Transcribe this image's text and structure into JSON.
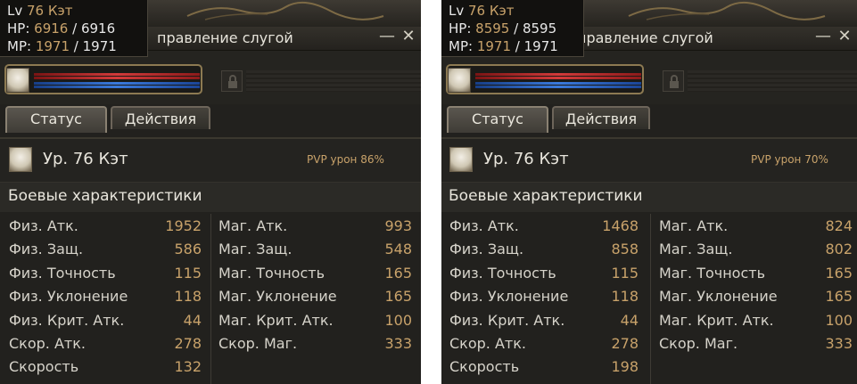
{
  "window_title": "правление слугой",
  "tabs": [
    "Статус",
    "Действия"
  ],
  "section_title": "Боевые характеристики",
  "panels": [
    {
      "tooltip": {
        "lv_label": "Lv",
        "lv_value": "76 Кэт",
        "hp_label": "HP:",
        "hp_cur": "6916",
        "hp_max": "/ 6916",
        "mp_label": "MP:",
        "mp_cur": "1971",
        "mp_max": "/ 1971"
      },
      "name_level_label": "Ур.",
      "name_level_value": "76 Кэт",
      "pvp": "PVP урон 86%",
      "left_stats": [
        {
          "label": "Физ. Атк.",
          "value": "1952"
        },
        {
          "label": "Физ. Защ.",
          "value": "586"
        },
        {
          "label": "Физ. Точность",
          "value": "115"
        },
        {
          "label": "Физ. Уклонение",
          "value": "118"
        },
        {
          "label": "Физ. Крит. Атк.",
          "value": "44"
        },
        {
          "label": "Скор. Атк.",
          "value": "278"
        },
        {
          "label": "Скорость",
          "value": "132"
        }
      ],
      "right_stats": [
        {
          "label": "Маг. Атк.",
          "value": "993"
        },
        {
          "label": "Маг. Защ.",
          "value": "548"
        },
        {
          "label": "Маг. Точность",
          "value": "165"
        },
        {
          "label": "Маг. Уклонение",
          "value": "165"
        },
        {
          "label": "Маг. Крит. Атк.",
          "value": "100"
        },
        {
          "label": "Скор. Маг.",
          "value": "333"
        }
      ]
    },
    {
      "tooltip": {
        "lv_label": "Lv",
        "lv_value": "76 Кэт",
        "hp_label": "HP:",
        "hp_cur": "8595",
        "hp_max": "/ 8595",
        "mp_label": "MP:",
        "mp_cur": "1971",
        "mp_max": "/ 1971"
      },
      "name_level_label": "Ур.",
      "name_level_value": "76 Кэт",
      "pvp": "PVP урон 70%",
      "left_stats": [
        {
          "label": "Физ. Атк.",
          "value": "1468"
        },
        {
          "label": "Физ. Защ.",
          "value": "858"
        },
        {
          "label": "Физ. Точность",
          "value": "115"
        },
        {
          "label": "Физ. Уклонение",
          "value": "118"
        },
        {
          "label": "Физ. Крит. Атк.",
          "value": "44"
        },
        {
          "label": "Скор. Атк.",
          "value": "278"
        },
        {
          "label": "Скорость",
          "value": "198"
        }
      ],
      "right_stats": [
        {
          "label": "Маг. Атк.",
          "value": "824"
        },
        {
          "label": "Маг. Защ.",
          "value": "802"
        },
        {
          "label": "Маг. Точность",
          "value": "165"
        },
        {
          "label": "Маг. Уклонение",
          "value": "165"
        },
        {
          "label": "Маг. Крит. Атк.",
          "value": "100"
        },
        {
          "label": "Скор. Маг.",
          "value": "333"
        }
      ]
    }
  ],
  "icons": {
    "minimize": "minimize-icon",
    "close": "close-icon",
    "lock": "lock-icon"
  },
  "colors": {
    "value_gold": "#c8a26a",
    "hp_red": "#d23a3a",
    "mp_blue": "#3a7adc",
    "frame_gold": "#8d7a52"
  }
}
